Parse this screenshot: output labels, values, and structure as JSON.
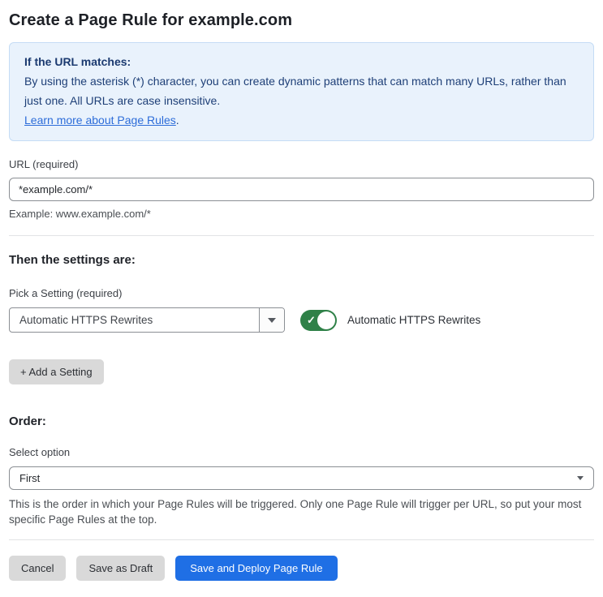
{
  "page": {
    "title": "Create a Page Rule for example.com"
  },
  "info_box": {
    "heading": "If the URL matches:",
    "body": "By using the asterisk (*) character, you can create dynamic patterns that can match many URLs, rather than just one. All URLs are case insensitive.",
    "link_label": "Learn more about Page Rules",
    "link_suffix": "."
  },
  "url_field": {
    "label": "URL (required)",
    "value": "*example.com/*",
    "helper": "Example: www.example.com/*"
  },
  "settings_section": {
    "heading": "Then the settings are:",
    "picker_label": "Pick a Setting (required)",
    "picker_value": "Automatic HTTPS Rewrites",
    "toggle_state": "on",
    "toggle_check_glyph": "✓",
    "toggle_label": "Automatic HTTPS Rewrites",
    "add_setting_label": "+ Add a Setting"
  },
  "order_section": {
    "heading": "Order:",
    "select_label": "Select option",
    "select_value": "First",
    "helper": "This is the order in which your Page Rules will be triggered. Only one Page Rule will trigger per URL, so put your most specific Page Rules at the top."
  },
  "footer": {
    "cancel_label": "Cancel",
    "save_draft_label": "Save as Draft",
    "save_deploy_label": "Save and Deploy Page Rule"
  },
  "colors": {
    "accent_blue": "#1f6fe5",
    "info_bg": "#e9f2fc",
    "info_border": "#c5dcf5",
    "info_text": "#1e3f77",
    "link_blue": "#2c6cd9",
    "toggle_green": "#2f8148",
    "button_gray": "#d9d9d9"
  }
}
